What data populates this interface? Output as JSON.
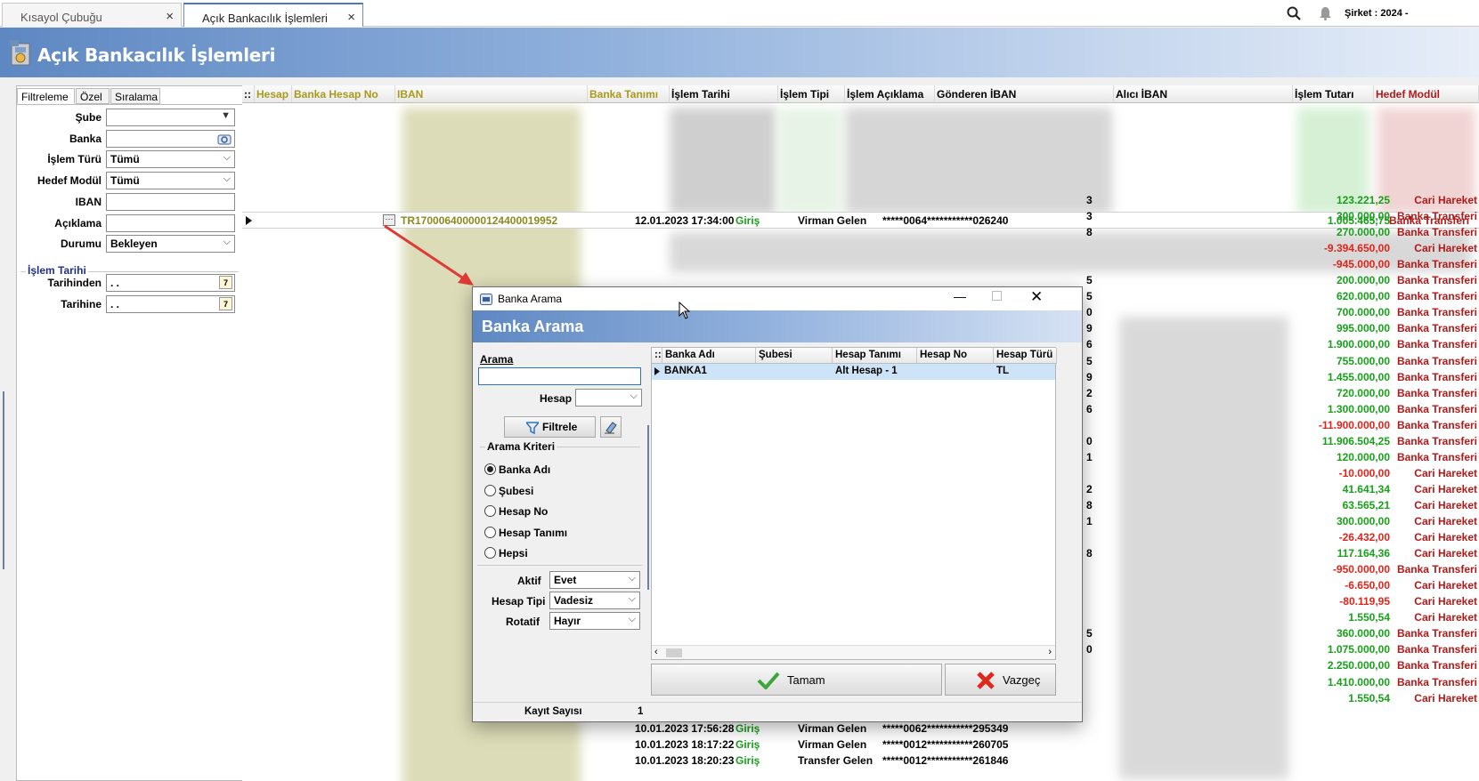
{
  "tabs": [
    {
      "label": "Kısayol Çubuğu",
      "active": false
    },
    {
      "label": "Açık Bankacılık İşlemleri",
      "active": true
    }
  ],
  "company": "Şirket : 2024 -",
  "page_title": "Açık Bankacılık İşlemleri",
  "filter_panel": {
    "tabs": [
      "Filtreleme",
      "Özel",
      "Sıralama"
    ],
    "fields": [
      {
        "label": "Şube",
        "value": ""
      },
      {
        "label": "Banka",
        "value": ""
      },
      {
        "label": "İşlem Türü",
        "value": "Tümü"
      },
      {
        "label": "Hedef Modül",
        "value": "Tümü"
      },
      {
        "label": "IBAN",
        "value": ""
      },
      {
        "label": "Açıklama",
        "value": ""
      },
      {
        "label": "Durumu",
        "value": "Bekleyen"
      }
    ],
    "date_group": "İşlem Tarihi",
    "date_from_label": "Tarihinden",
    "date_to_label": "Tarihine",
    "date_from": " . .",
    "date_to": " . ."
  },
  "grid": {
    "columns": [
      "::",
      "Hesap",
      "Banka Hesap No",
      "IBAN",
      "Banka Tanımı",
      "İşlem Tarihi",
      "İşlem Tipi",
      "İşlem Açıklama",
      "Gönderen İBAN",
      "Alıcı İBAN",
      "İşlem Tutarı",
      "Hedef Modül"
    ],
    "selected_row": {
      "iban": "TR170006400000124400019952",
      "date": "12.01.2023 17:34:00",
      "type": "Giriş",
      "desc": "Virman Gelen",
      "sender": "*****0064***********026240",
      "amount": "1.005.465,75",
      "module": "Banka Transferi"
    },
    "amounts": [
      {
        "amount": "123.221,25",
        "module": "Cari Hareket",
        "neg": false
      },
      {
        "amount": "300.000,00",
        "module": "Banka Transferi",
        "neg": false
      },
      {
        "amount": "270.000,00",
        "module": "Banka Transferi",
        "neg": false
      },
      {
        "amount": "-9.394.650,00",
        "module": "Cari Hareket",
        "neg": true
      },
      {
        "amount": "-945.000,00",
        "module": "Banka Transferi",
        "neg": true
      },
      {
        "amount": "200.000,00",
        "module": "Banka Transferi",
        "neg": false
      },
      {
        "amount": "620.000,00",
        "module": "Banka Transferi",
        "neg": false
      },
      {
        "amount": "700.000,00",
        "module": "Banka Transferi",
        "neg": false
      },
      {
        "amount": "995.000,00",
        "module": "Banka Transferi",
        "neg": false
      },
      {
        "amount": "1.900.000,00",
        "module": "Banka Transferi",
        "neg": false
      },
      {
        "amount": "755.000,00",
        "module": "Banka Transferi",
        "neg": false
      },
      {
        "amount": "1.455.000,00",
        "module": "Banka Transferi",
        "neg": false
      },
      {
        "amount": "720.000,00",
        "module": "Banka Transferi",
        "neg": false
      },
      {
        "amount": "1.300.000,00",
        "module": "Banka Transferi",
        "neg": false
      },
      {
        "amount": "-11.900.000,00",
        "module": "Banka Transferi",
        "neg": true
      },
      {
        "amount": "11.906.504,25",
        "module": "Banka Transferi",
        "neg": false
      },
      {
        "amount": "120.000,00",
        "module": "Banka Transferi",
        "neg": false
      },
      {
        "amount": "-10.000,00",
        "module": "Cari Hareket",
        "neg": true
      },
      {
        "amount": "41.641,34",
        "module": "Cari Hareket",
        "neg": false
      },
      {
        "amount": "63.565,21",
        "module": "Cari Hareket",
        "neg": false
      },
      {
        "amount": "300.000,00",
        "module": "Cari Hareket",
        "neg": false
      },
      {
        "amount": "-26.432,00",
        "module": "Cari Hareket",
        "neg": true
      },
      {
        "amount": "117.164,36",
        "module": "Cari Hareket",
        "neg": false
      },
      {
        "amount": "-950.000,00",
        "module": "Banka Transferi",
        "neg": true
      },
      {
        "amount": "-6.650,00",
        "module": "Cari Hareket",
        "neg": true
      },
      {
        "amount": "-80.119,95",
        "module": "Cari Hareket",
        "neg": true
      },
      {
        "amount": "1.550,54",
        "module": "Cari Hareket",
        "neg": false
      },
      {
        "amount": "360.000,00",
        "module": "Banka Transferi",
        "neg": false
      },
      {
        "amount": "1.075.000,00",
        "module": "Banka Transferi",
        "neg": false
      },
      {
        "amount": "2.250.000,00",
        "module": "Banka Transferi",
        "neg": false
      },
      {
        "amount": "1.410.000,00",
        "module": "Banka Transferi",
        "neg": false
      },
      {
        "amount": "1.550,54",
        "module": "Cari Hareket",
        "neg": false
      }
    ],
    "sender_tail_digits": [
      "3",
      "3",
      "8",
      "",
      "",
      "5",
      "5",
      "0",
      "9",
      "6",
      "5",
      "9",
      "2",
      "6",
      "",
      "0",
      "1",
      "",
      "2",
      "8",
      "1",
      "",
      "8",
      "",
      "",
      "",
      "",
      "5",
      "0"
    ],
    "bottom_rows": [
      {
        "date": "10.01.2023 17:56:28",
        "type": "Giriş",
        "desc": "Virman Gelen",
        "sender": "*****0062***********295349"
      },
      {
        "date": "10.01.2023 18:17:22",
        "type": "Giriş",
        "desc": "Virman Gelen",
        "sender": "*****0012***********260705"
      },
      {
        "date": "10.01.2023 18:20:23",
        "type": "Giriş",
        "desc": "Transfer Gelen",
        "sender": "*****0012***********261846"
      }
    ]
  },
  "dialog": {
    "window_title": "Banka Arama",
    "banner_title": "Banka Arama",
    "search_label": "Arama",
    "search_value": "",
    "hesap_label": "Hesap",
    "hesap_value": "",
    "filter_button": "Filtrele",
    "criteria_title": "Arama Kriteri",
    "criteria": [
      {
        "label": "Banka Adı",
        "selected": true
      },
      {
        "label": "Şubesi",
        "selected": false
      },
      {
        "label": "Hesap No",
        "selected": false
      },
      {
        "label": "Hesap Tanımı",
        "selected": false
      },
      {
        "label": "Hepsi",
        "selected": false
      }
    ],
    "aktif_label": "Aktif",
    "aktif_value": "Evet",
    "hesap_tipi_label": "Hesap Tipi",
    "hesap_tipi_value": "Vadesiz",
    "rotatif_label": "Rotatif",
    "rotatif_value": "Hayır",
    "kayit_label": "Kayıt Sayısı",
    "kayit_value": "1",
    "columns": [
      "::",
      "Banka Adı",
      "Şubesi",
      "Hesap Tanımı",
      "Hesap No",
      "Hesap Türü"
    ],
    "rows": [
      {
        "banka": "BANKA1",
        "sube": "",
        "tanim": "Alt Hesap - 1",
        "no": "",
        "tur": "TL"
      }
    ],
    "ok_button": "Tamam",
    "cancel_button": "Vazgeç"
  }
}
